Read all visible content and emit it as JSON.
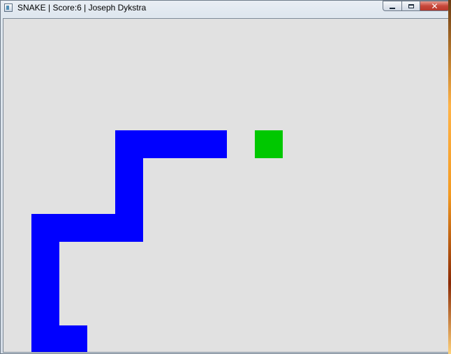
{
  "window": {
    "title": "SNAKE | Score:6 | Joseph Dykstra",
    "app_icon": "window-app-icon"
  },
  "controls": {
    "minimize_icon": "minimize-icon",
    "maximize_icon": "maximize-icon",
    "close_label": "✕"
  },
  "game": {
    "background_color": "#e1e1e1",
    "snake_color": "#0000ff",
    "food_color": "#00c800",
    "grid_columns": 16,
    "grid_rows": 12,
    "snake": [
      {
        "col": 7,
        "row": 4
      },
      {
        "col": 6,
        "row": 4
      },
      {
        "col": 5,
        "row": 4
      },
      {
        "col": 4,
        "row": 4
      },
      {
        "col": 4,
        "row": 5
      },
      {
        "col": 4,
        "row": 6
      },
      {
        "col": 3,
        "row": 7
      },
      {
        "col": 2,
        "row": 7
      },
      {
        "col": 1,
        "row": 7
      },
      {
        "col": 1,
        "row": 8
      },
      {
        "col": 1,
        "row": 9
      },
      {
        "col": 1,
        "row": 10
      },
      {
        "col": 1,
        "row": 11
      },
      {
        "col": 2,
        "row": 11
      },
      {
        "col": 4,
        "row": 7
      }
    ],
    "food": {
      "col": 9,
      "row": 4
    }
  }
}
